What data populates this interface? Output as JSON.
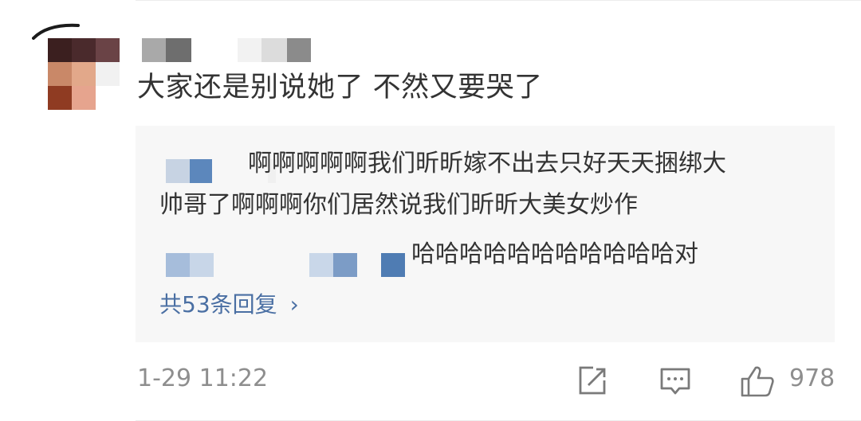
{
  "comment": {
    "text": "大家还是别说她了 不然又要哭了",
    "timestamp": "1-29 11:22",
    "like_count": "978"
  },
  "replies": [
    {
      "line1": "啊啊啊啊啊我们昕昕嫁不出去只好天天捆绑大",
      "line2": "帅哥了啊啊啊你们居然说我们昕昕大美女炒作"
    },
    {
      "text": "哈哈哈哈哈哈哈哈哈哈哈对"
    }
  ],
  "more_replies_label": "共53条回复",
  "icons": {
    "share": "share-icon",
    "reply": "comment-icon",
    "like": "thumbs-up-icon",
    "more": "chevron-right-icon"
  },
  "colors": {
    "link": "#4a6fa3",
    "muted": "#8e8e8e",
    "reply_bg": "#f7f7f7"
  }
}
